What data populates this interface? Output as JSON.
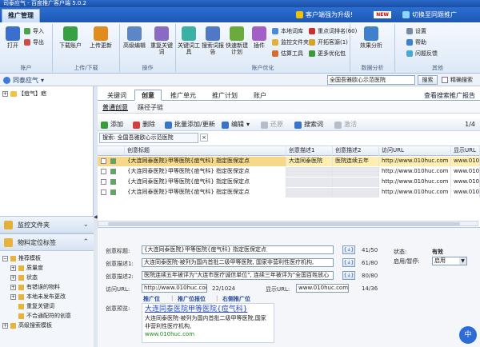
{
  "titlebar": {
    "text": "司泰应气 - 百度推广客户端 5.0.2"
  },
  "menubar": {
    "active_tab": "推广管理",
    "upgrade": "客户端强为升级!",
    "new_badge": "NEW",
    "switch": "切换至同题推广"
  },
  "ribbon": {
    "account": {
      "label": "账户",
      "open": "打开",
      "import": "导入",
      "export": "导出"
    },
    "transfer": {
      "label": "上传/下载",
      "download": "下载账户",
      "upload": "上传更新"
    },
    "ops": {
      "label": "操作",
      "adv_edit": "高级编辑",
      "restore_kw": "重复关键词"
    },
    "tools": {
      "label": "账户优化",
      "kw_tool": "关键词工具",
      "search_report": "搜索词报告",
      "quick_new": "快速新建计划",
      "plugin": "插件",
      "local_lib": "本地词库",
      "monitor_folder": "监控文件夹",
      "estimate": "估算工具",
      "key_word_rank": "重点词排名(60)",
      "open_source": "开拓客源(1)",
      "more_opt": "更多优化包"
    },
    "data": {
      "label": "数据分析",
      "analysis": "效果分析"
    },
    "other": {
      "label": "其他",
      "settings": "设置",
      "help": "帮助",
      "feedback": "问题反馈"
    }
  },
  "accountbar": {
    "name": "同泰应气",
    "search_value": "全国吾雅欧心示范医院",
    "search_btn": "搜索",
    "exact_label": "精确搜索"
  },
  "tree": {
    "root": "【痘气】疤"
  },
  "panels": {
    "monitor": "监控文件夹",
    "material": "物料定位标签",
    "items": [
      {
        "label": "推荐模板",
        "level": 0
      },
      {
        "label": "质量度",
        "level": 1
      },
      {
        "label": "状态",
        "level": 1
      },
      {
        "label": "有错误的物料",
        "level": 1
      },
      {
        "label": "本地未发布更改",
        "level": 1
      },
      {
        "label": "重复关键词",
        "level": 1
      },
      {
        "label": "不合通配符的创意",
        "level": 1
      },
      {
        "label": "高级搜索模板",
        "level": 0
      }
    ]
  },
  "main": {
    "tabs": [
      "关键词",
      "创意",
      "推广单元",
      "推广计划",
      "账户"
    ],
    "active_tab": 1,
    "adv_link": "查看搜索推广报告",
    "subtabs": [
      "普通创意",
      "蹊径子链"
    ],
    "toolbar": {
      "add": "添加",
      "delete": "删除",
      "batch": "批量添加/更新",
      "edit": "编辑",
      "restore": "还原",
      "search_word": "搜索词",
      "activate": "激活",
      "page": "1/4"
    },
    "filter": "搜索: 全国吾雅欧心示范医院"
  },
  "grid": {
    "headers": [
      "创意标题",
      "创意描述1",
      "创意描述2",
      "访问URL",
      "显示URL"
    ],
    "rows": [
      {
        "title": "{大连同泰医院}甲等医院{痘气科} 指定医保定点",
        "d1": "大连同泰医院",
        "d2": "医院连续五年",
        "url": "http://www.010huc.com",
        "durl": "www.010huc.com",
        "sel": true
      },
      {
        "title": "{大连同泰医院}甲等医院{痘气科} 指定医保定点",
        "d1": "",
        "d2": "",
        "url": "http://www.010huc.com",
        "durl": "www.010huc.com",
        "sel": false
      },
      {
        "title": "{大连同泰医院}甲等医院{痘气科} 指定医保定点",
        "d1": "",
        "d2": "",
        "url": "http://www.010huc.com",
        "durl": "www.010huc.com",
        "sel": false
      },
      {
        "title": "{大连同泰医院}甲等医院{痘气科} 指定医保定点",
        "d1": "",
        "d2": "",
        "url": "http://www.010huc.com",
        "durl": "www.010huc.com",
        "sel": false
      }
    ]
  },
  "editor": {
    "title_label": "创意标题:",
    "title_value": "{大连同泰医院}甲等医院{痘气科} 指定医保定点",
    "title_count": "41/50",
    "d1_label": "创意描述1:",
    "d1_value": "大连同泰医院-被列为国内首批二级甲等医院, 国家非营利性医疗机构,",
    "d1_count": "61/80",
    "d2_label": "创意描述2:",
    "d2_value": "医院连续五年被评为\"大连市医疗诚信单位\", 连续三年被评为\"全国百姓放心",
    "d2_count": "80/80",
    "url_label": "访问URL:",
    "url_value": "http://www.010huc.com",
    "url_count": "22/1024",
    "durl_label": "显示URL:",
    "durl_value": "www.010huc.com",
    "durl_count": "14/36",
    "links": [
      "推广位",
      "推广位报位",
      "右侧推广位"
    ],
    "preview_label": "创意预览:",
    "preview_title": "大连同泰医院甲等医院{痘气科}",
    "preview_desc": "大连同泰医院-被列为国内首批二级甲等医院,国家非营利性医疗机构,",
    "preview_url": "www.010huc.com",
    "status_label": "状态:",
    "status_value": "有效",
    "pause_label": "启用/暂停:",
    "pause_value": "启用"
  },
  "corner": "中"
}
